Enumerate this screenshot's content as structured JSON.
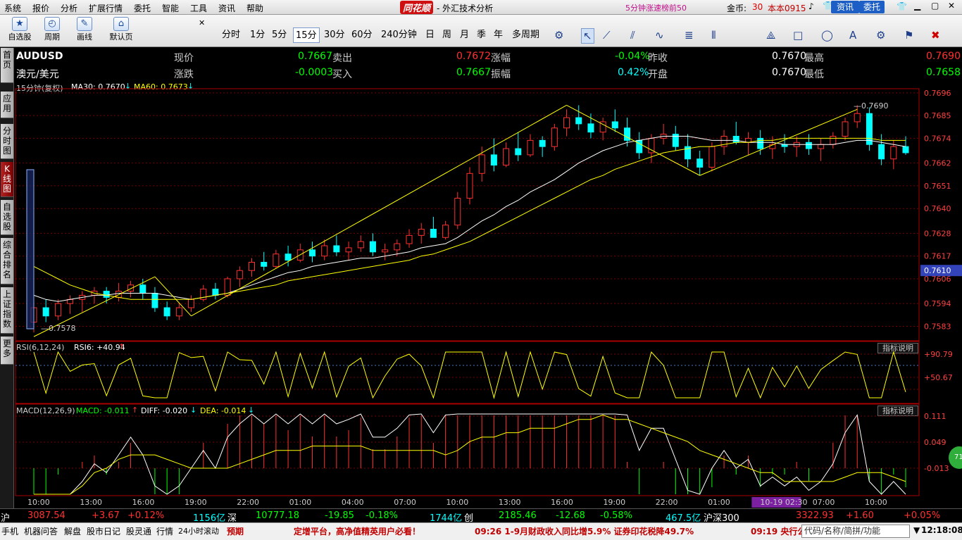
{
  "menu": [
    "系统",
    "报价",
    "分析",
    "扩展行情",
    "委托",
    "智能",
    "工具",
    "资讯",
    "帮助"
  ],
  "brand": "同花顺",
  "window_title": "- 外汇技术分析",
  "topright": {
    "speed": "5分钟涨速榜前50",
    "coins_label": "金币:",
    "coins": "30",
    "account": "本本0915",
    "news_btn": "资讯",
    "trade_btn": "委托"
  },
  "toolbar": {
    "buttons": [
      {
        "label": "自选股",
        "icon": "★"
      },
      {
        "label": "周期",
        "icon": "◴"
      },
      {
        "label": "画线",
        "icon": "✎"
      },
      {
        "label": "默认页",
        "icon": "⌂"
      }
    ],
    "periods": [
      "分时",
      "1分",
      "5分",
      "15分",
      "30分",
      "60分",
      "240分钟",
      "日",
      "周",
      "月",
      "季",
      "年",
      "多周期"
    ],
    "active_period": "15分",
    "tools": [
      "↖",
      "⟋",
      "⫽",
      "∿",
      "≣",
      "⦀",
      "⟁",
      "□",
      "◯",
      "A",
      "⚙",
      "⚑",
      "✖"
    ]
  },
  "sidebar": [
    {
      "label": "首页"
    },
    {
      "label": "应用"
    },
    {
      "label": "分时图"
    },
    {
      "label": "K线图"
    },
    {
      "label": "自选股"
    },
    {
      "label": "综合排名"
    },
    {
      "label": "上证指数"
    },
    {
      "label": "更多"
    }
  ],
  "quote": {
    "code": "AUDUSD",
    "name": "澳元/美元",
    "row1": [
      [
        "现价",
        "0.7667",
        "#00ff00"
      ],
      [
        "卖出",
        "0.7672",
        "#ff3030"
      ],
      [
        "涨幅",
        "-0.04%",
        "#00ff00"
      ],
      [
        "昨收",
        "0.7670",
        "#ffffff"
      ],
      [
        "最高",
        "0.7690",
        "#ff3030"
      ]
    ],
    "row2": [
      [
        "涨跌",
        "-0.0003",
        "#00ff00"
      ],
      [
        "买入",
        "0.7667",
        "#00ff00"
      ],
      [
        "振幅",
        "0.42%",
        "#00ffff"
      ],
      [
        "开盘",
        "0.7670",
        "#ffffff"
      ],
      [
        "最低",
        "0.7658",
        "#00ff00"
      ]
    ]
  },
  "ma_legend": {
    "period": "15分钟(复权)",
    "ma30": "MA30: 0.7670",
    "ma60": "MA60: 0.7673"
  },
  "rsi_legend": {
    "name": "RSI(6,12,24)",
    "rsi6": "RSI6: +40.94"
  },
  "macd_legend": {
    "name": "MACD(12,26,9)",
    "macd": "MACD: -0.011",
    "diff": "DIFF: -0.020",
    "dea": "DEA: -0.014"
  },
  "indicator_btn": "指标说明",
  "badge": "71",
  "colors": {
    "up": "#ff3030",
    "down": "#00ffff",
    "ma30": "#ffffff",
    "ma60": "#ffff00",
    "grid": "#7a0000"
  },
  "chart_data": {
    "type": "candlestick",
    "price_axis": {
      "ticks": [
        "0.7696",
        "0.7685",
        "0.7674",
        "0.7662",
        "0.7651",
        "0.7640",
        "0.7628",
        "0.7617",
        "0.7606",
        "0.7594",
        "0.7583"
      ],
      "current": "0.7610",
      "range": [
        0.7576,
        0.7698
      ]
    },
    "high_label": "0.7690",
    "low_label": "0.7578",
    "time_axis": [
      "10:00",
      "13:00",
      "16:00",
      "19:00",
      "22:00",
      "01:00",
      "04:00",
      "07:00",
      "10:00",
      "13:00",
      "16:00",
      "19:00",
      "22:00",
      "01:00",
      "10-19 02:30",
      "07:00",
      "10:00"
    ],
    "rsi_axis": [
      "+90.79",
      "+50.67"
    ],
    "macd_axis": [
      "0.111",
      "0.049",
      "-0.013"
    ],
    "trend_lines": [
      [
        [
          0.7578,
          0
        ],
        [
          0.7606,
          0.7
        ]
      ],
      [
        [
          0.7606,
          0.7
        ],
        [
          0.7592,
          1
        ]
      ]
    ],
    "ohlc": [
      [
        0.7585,
        0.7595,
        0.758,
        0.7592
      ],
      [
        0.7592,
        0.7596,
        0.7585,
        0.7588
      ],
      [
        0.7588,
        0.7596,
        0.7586,
        0.7594
      ],
      [
        0.7594,
        0.7598,
        0.7589,
        0.7596
      ],
      [
        0.7596,
        0.76,
        0.759,
        0.7598
      ],
      [
        0.7598,
        0.7602,
        0.7594,
        0.76
      ],
      [
        0.76,
        0.7602,
        0.7594,
        0.7597
      ],
      [
        0.7597,
        0.7604,
        0.7595,
        0.76
      ],
      [
        0.76,
        0.7605,
        0.7597,
        0.7603
      ],
      [
        0.7603,
        0.7606,
        0.7596,
        0.7599
      ],
      [
        0.7599,
        0.7602,
        0.759,
        0.7592
      ],
      [
        0.7592,
        0.7595,
        0.7586,
        0.7588
      ],
      [
        0.7588,
        0.7594,
        0.7586,
        0.7592
      ],
      [
        0.7592,
        0.7598,
        0.759,
        0.7596
      ],
      [
        0.7596,
        0.7603,
        0.7595,
        0.7601
      ],
      [
        0.7601,
        0.7604,
        0.7596,
        0.7598
      ],
      [
        0.7598,
        0.7607,
        0.7597,
        0.7606
      ],
      [
        0.7606,
        0.7612,
        0.7602,
        0.761
      ],
      [
        0.761,
        0.7616,
        0.7607,
        0.7614
      ],
      [
        0.7614,
        0.7619,
        0.761,
        0.7612
      ],
      [
        0.7612,
        0.762,
        0.7611,
        0.7618
      ],
      [
        0.7618,
        0.7622,
        0.7612,
        0.7615
      ],
      [
        0.7615,
        0.7623,
        0.7614,
        0.762
      ],
      [
        0.762,
        0.7624,
        0.7614,
        0.7617
      ],
      [
        0.7617,
        0.7625,
        0.7615,
        0.7622
      ],
      [
        0.7622,
        0.7627,
        0.7617,
        0.7619
      ],
      [
        0.7619,
        0.7624,
        0.7615,
        0.7621
      ],
      [
        0.7621,
        0.7627,
        0.7619,
        0.7624
      ],
      [
        0.7624,
        0.7628,
        0.7617,
        0.7619
      ],
      [
        0.7619,
        0.7623,
        0.7615,
        0.762
      ],
      [
        0.762,
        0.7625,
        0.7617,
        0.7623
      ],
      [
        0.7623,
        0.763,
        0.7621,
        0.7627
      ],
      [
        0.7627,
        0.7633,
        0.7623,
        0.763
      ],
      [
        0.763,
        0.7636,
        0.7627,
        0.7626
      ],
      [
        0.7626,
        0.7634,
        0.7625,
        0.7632
      ],
      [
        0.7632,
        0.7648,
        0.763,
        0.7645
      ],
      [
        0.7645,
        0.766,
        0.7642,
        0.7657
      ],
      [
        0.7657,
        0.767,
        0.7653,
        0.7666
      ],
      [
        0.7666,
        0.7674,
        0.7658,
        0.7661
      ],
      [
        0.7661,
        0.7672,
        0.766,
        0.7669
      ],
      [
        0.7669,
        0.7677,
        0.7663,
        0.7666
      ],
      [
        0.7666,
        0.7676,
        0.7665,
        0.7673
      ],
      [
        0.7673,
        0.7675,
        0.7665,
        0.767
      ],
      [
        0.767,
        0.7681,
        0.7668,
        0.7679
      ],
      [
        0.7679,
        0.7688,
        0.7675,
        0.7684
      ],
      [
        0.7684,
        0.769,
        0.7678,
        0.7681
      ],
      [
        0.7681,
        0.7686,
        0.7674,
        0.7677
      ],
      [
        0.7677,
        0.7684,
        0.7673,
        0.7682
      ],
      [
        0.7682,
        0.7688,
        0.7677,
        0.7679
      ],
      [
        0.7679,
        0.7684,
        0.767,
        0.7673
      ],
      [
        0.7673,
        0.7677,
        0.7664,
        0.7667
      ],
      [
        0.7667,
        0.7676,
        0.7662,
        0.7674
      ],
      [
        0.7674,
        0.7681,
        0.7671,
        0.7676
      ],
      [
        0.7676,
        0.768,
        0.7668,
        0.767
      ],
      [
        0.767,
        0.7676,
        0.766,
        0.7664
      ],
      [
        0.7664,
        0.7668,
        0.7656,
        0.766
      ],
      [
        0.766,
        0.7672,
        0.7658,
        0.767
      ],
      [
        0.767,
        0.7678,
        0.7666,
        0.7675
      ],
      [
        0.7675,
        0.7682,
        0.7671,
        0.7672
      ],
      [
        0.7672,
        0.7677,
        0.7666,
        0.7674
      ],
      [
        0.7674,
        0.7678,
        0.7666,
        0.7669
      ],
      [
        0.7669,
        0.7675,
        0.7664,
        0.7671
      ],
      [
        0.7671,
        0.7676,
        0.7667,
        0.767
      ],
      [
        0.767,
        0.7675,
        0.7665,
        0.7672
      ],
      [
        0.7672,
        0.7676,
        0.7666,
        0.7669
      ],
      [
        0.7669,
        0.7674,
        0.7663,
        0.7671
      ],
      [
        0.7671,
        0.7677,
        0.7669,
        0.7675
      ],
      [
        0.7675,
        0.7684,
        0.7673,
        0.7682
      ],
      [
        0.7682,
        0.769,
        0.7679,
        0.7686
      ],
      [
        0.7686,
        0.7689,
        0.7668,
        0.7671
      ],
      [
        0.7671,
        0.7676,
        0.7661,
        0.7664
      ],
      [
        0.7664,
        0.7673,
        0.7659,
        0.767
      ],
      [
        0.767,
        0.7675,
        0.7666,
        0.7667
      ]
    ],
    "ma30": [
      0.7598,
      0.7596,
      0.7595,
      0.7596,
      0.7597,
      0.7598,
      0.7598,
      0.7599,
      0.7599,
      0.7599,
      0.7599,
      0.7598,
      0.7597,
      0.7596,
      0.7597,
      0.7598,
      0.7599,
      0.7601,
      0.7603,
      0.7605,
      0.7607,
      0.7609,
      0.761,
      0.7612,
      0.7613,
      0.7614,
      0.7615,
      0.7616,
      0.7616,
      0.7617,
      0.7618,
      0.7619,
      0.7621,
      0.7622,
      0.7623,
      0.7626,
      0.763,
      0.7634,
      0.7637,
      0.7641,
      0.7644,
      0.7648,
      0.7651,
      0.7654,
      0.7658,
      0.7662,
      0.7665,
      0.7668,
      0.767,
      0.7672,
      0.7673,
      0.7674,
      0.7675,
      0.7675,
      0.7675,
      0.7674,
      0.7673,
      0.7673,
      0.7673,
      0.7672,
      0.7672,
      0.7672,
      0.7671,
      0.7671,
      0.7671,
      0.7671,
      0.7671,
      0.7672,
      0.7673,
      0.7673,
      0.7672,
      0.7671,
      0.767
    ],
    "ma60": [
      0.7612,
      0.7609,
      0.7606,
      0.7603,
      0.7601,
      0.7599,
      0.7598,
      0.7597,
      0.7596,
      0.7596,
      0.7596,
      0.7596,
      0.7596,
      0.7596,
      0.7597,
      0.7598,
      0.7599,
      0.76,
      0.7601,
      0.7602,
      0.7603,
      0.7605,
      0.7606,
      0.7607,
      0.7608,
      0.7609,
      0.761,
      0.7611,
      0.7612,
      0.7613,
      0.7614,
      0.7615,
      0.7617,
      0.7618,
      0.762,
      0.7622,
      0.7624,
      0.7627,
      0.763,
      0.7633,
      0.7636,
      0.7639,
      0.7642,
      0.7645,
      0.7648,
      0.7651,
      0.7654,
      0.7656,
      0.7659,
      0.7661,
      0.7663,
      0.7665,
      0.7667,
      0.7668,
      0.7669,
      0.767,
      0.767,
      0.7671,
      0.7672,
      0.7672,
      0.7673,
      0.7673,
      0.7674,
      0.7674,
      0.7674,
      0.7674,
      0.7674,
      0.7674,
      0.7674,
      0.7674,
      0.7673,
      0.7673,
      0.7673
    ]
  },
  "footer": {
    "sh": "沪",
    "sh_index": "3087.54",
    "sh_chg": "+3.67",
    "sh_pct": "+0.12%",
    "sh_amt": "1156亿",
    "sz": "深",
    "sz_index": "10777.18",
    "sz_chg": "-19.85",
    "sz_pct": "-0.18%",
    "sz_amt": "1744亿",
    "cy": "创",
    "cy_index": "2185.46",
    "cy_chg": "-12.68",
    "cy_pct": "-0.58%",
    "cy_amt": "467.5亿",
    "hs": "沪深300",
    "hs_index": "3322.93",
    "hs_chg": "+1.60",
    "hs_pct": "+0.05%"
  },
  "statusbar": {
    "items": [
      "手机",
      "机器问答",
      "解盘",
      "股市日记",
      "股灵通",
      "行情",
      "24小时滚动",
      "预期"
    ],
    "ad": "定增平台，高净值精英用户必看！",
    "news1": "09:26 1-9月财政收入同比增5.9% 证券印花税降49.7%",
    "news2": "09:19 央行公",
    "search": "代码/名称/简拼/功能",
    "time": "12:18:08"
  }
}
